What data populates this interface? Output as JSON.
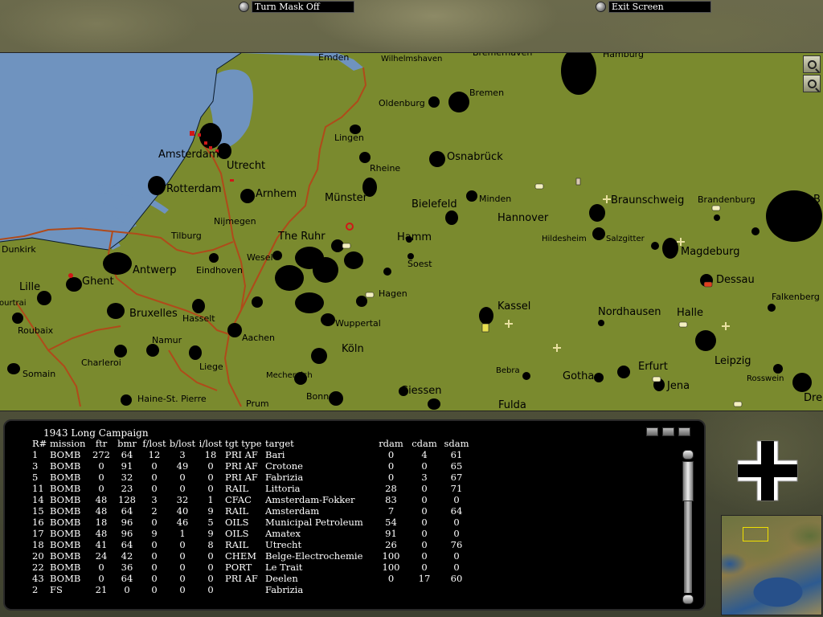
{
  "top_bar": {
    "turn_mask_label": "Turn Mask Off",
    "exit_label": "Exit Screen"
  },
  "map": {
    "cities": [
      {
        "name": "Emden",
        "size": "normal"
      },
      {
        "name": "Wilhelmshaven",
        "size": "small"
      },
      {
        "name": "Bremerhaven",
        "size": "normal"
      },
      {
        "name": "Hamburg",
        "size": "normal"
      },
      {
        "name": "Oldenburg",
        "size": "normal"
      },
      {
        "name": "Bremen",
        "size": "normal"
      },
      {
        "name": "Lingen",
        "size": "normal"
      },
      {
        "name": "Amsterdam",
        "size": "big"
      },
      {
        "name": "Osnabrück",
        "size": "big"
      },
      {
        "name": "Utrecht",
        "size": "big"
      },
      {
        "name": "Rheine",
        "size": "normal"
      },
      {
        "name": "Rotterdam",
        "size": "big"
      },
      {
        "name": "Arnhem",
        "size": "big"
      },
      {
        "name": "Münster",
        "size": "big"
      },
      {
        "name": "Bielefeld",
        "size": "big"
      },
      {
        "name": "Minden",
        "size": "normal"
      },
      {
        "name": "Braunschweig",
        "size": "big"
      },
      {
        "name": "Brandenburg",
        "size": "normal"
      },
      {
        "name": "B",
        "size": "big"
      },
      {
        "name": "Hannover",
        "size": "big"
      },
      {
        "name": "Nijmegen",
        "size": "normal"
      },
      {
        "name": "Tilburg",
        "size": "normal"
      },
      {
        "name": "The Ruhr",
        "size": "big"
      },
      {
        "name": "Hamm",
        "size": "big"
      },
      {
        "name": "Hildesheim",
        "size": "small"
      },
      {
        "name": "Salzgitter",
        "size": "small"
      },
      {
        "name": "Dunkirk",
        "size": "normal"
      },
      {
        "name": "Wesel",
        "size": "normal"
      },
      {
        "name": "Soest",
        "size": "normal"
      },
      {
        "name": "Magdeburg",
        "size": "big"
      },
      {
        "name": "Antwerp",
        "size": "big"
      },
      {
        "name": "Eindhoven",
        "size": "normal"
      },
      {
        "name": "Ghent",
        "size": "big"
      },
      {
        "name": "Dessau",
        "size": "big"
      },
      {
        "name": "Lille",
        "size": "big"
      },
      {
        "name": "Hagen",
        "size": "normal"
      },
      {
        "name": "ourtrai",
        "size": "small"
      },
      {
        "name": "Kassel",
        "size": "big"
      },
      {
        "name": "Nordhausen",
        "size": "big"
      },
      {
        "name": "Halle",
        "size": "big"
      },
      {
        "name": "Falkenberg",
        "size": "normal"
      },
      {
        "name": "Bruxelles",
        "size": "big"
      },
      {
        "name": "Hasselt",
        "size": "normal"
      },
      {
        "name": "Roubaix",
        "size": "normal"
      },
      {
        "name": "Wuppertal",
        "size": "normal"
      },
      {
        "name": "Aachen",
        "size": "normal"
      },
      {
        "name": "Namur",
        "size": "normal"
      },
      {
        "name": "Köln",
        "size": "big"
      },
      {
        "name": "Leipzig",
        "size": "big"
      },
      {
        "name": "Charleroi",
        "size": "normal"
      },
      {
        "name": "Liege",
        "size": "normal"
      },
      {
        "name": "Somain",
        "size": "normal"
      },
      {
        "name": "Mechernich",
        "size": "small"
      },
      {
        "name": "Bebra",
        "size": "small"
      },
      {
        "name": "Gotha",
        "size": "big"
      },
      {
        "name": "Erfurt",
        "size": "big"
      },
      {
        "name": "Rosswein",
        "size": "small"
      },
      {
        "name": "Jena",
        "size": "big"
      },
      {
        "name": "Haine-St. Pierre",
        "size": "normal"
      },
      {
        "name": "Bonn",
        "size": "normal"
      },
      {
        "name": "Giessen",
        "size": "big"
      },
      {
        "name": "Dre",
        "size": "big"
      },
      {
        "name": "Prum",
        "size": "normal"
      },
      {
        "name": "Fulda",
        "size": "big"
      }
    ],
    "zoom_in_icon": "zoom-in-icon",
    "zoom_out_icon": "zoom-out-icon",
    "colors": {
      "land": "#7a8a2e",
      "sea": "#6f93bf",
      "border": "#b04a1a",
      "flak": "#000000"
    }
  },
  "panel": {
    "title": "1943 Long Campaign",
    "columns": [
      "R#",
      "mission",
      "ftr",
      "bmr",
      "f/lost",
      "b/lost",
      "i/lost",
      "tgt type",
      "target",
      "rdam",
      "cdam",
      "sdam"
    ],
    "rows": [
      [
        "1",
        "BOMB",
        "272",
        "64",
        "12",
        "3",
        "18",
        "PRI AF",
        "Bari",
        "0",
        "4",
        "61"
      ],
      [
        "3",
        "BOMB",
        "0",
        "91",
        "0",
        "49",
        "0",
        "PRI AF",
        "Crotone",
        "0",
        "0",
        "65"
      ],
      [
        "5",
        "BOMB",
        "0",
        "32",
        "0",
        "0",
        "0",
        "PRI AF",
        "Fabrizia",
        "0",
        "3",
        "67"
      ],
      [
        "11",
        "BOMB",
        "0",
        "23",
        "0",
        "0",
        "0",
        "RAIL",
        "Littoria",
        "28",
        "0",
        "71"
      ],
      [
        "14",
        "BOMB",
        "48",
        "128",
        "3",
        "32",
        "1",
        "CFAC",
        "Amsterdam-Fokker",
        "83",
        "0",
        "0"
      ],
      [
        "15",
        "BOMB",
        "48",
        "64",
        "2",
        "40",
        "9",
        "RAIL",
        "Amsterdam",
        "7",
        "0",
        "64"
      ],
      [
        "16",
        "BOMB",
        "18",
        "96",
        "0",
        "46",
        "5",
        "OILS",
        "Municipal Petroleum",
        "54",
        "0",
        "0"
      ],
      [
        "17",
        "BOMB",
        "48",
        "96",
        "9",
        "1",
        "9",
        "OILS",
        "Amatex",
        "91",
        "0",
        "0"
      ],
      [
        "18",
        "BOMB",
        "41",
        "64",
        "0",
        "0",
        "8",
        "RAIL",
        "Utrecht",
        "26",
        "0",
        "76"
      ],
      [
        "20",
        "BOMB",
        "24",
        "42",
        "0",
        "0",
        "0",
        "CHEM",
        "Belge-Electrochemie",
        "100",
        "0",
        "0"
      ],
      [
        "22",
        "BOMB",
        "0",
        "36",
        "0",
        "0",
        "0",
        "PORT",
        "Le Trait",
        "100",
        "0",
        "0"
      ],
      [
        "43",
        "BOMB",
        "0",
        "64",
        "0",
        "0",
        "0",
        "PRI AF",
        "Deelen",
        "0",
        "17",
        "60"
      ],
      [
        "2",
        "FS",
        "21",
        "0",
        "0",
        "0",
        "0",
        "",
        "Fabrizia",
        "",
        "",
        ""
      ]
    ]
  },
  "emblem_icon": "balkenkreuz-icon",
  "minimap_icon": "europe-minimap"
}
